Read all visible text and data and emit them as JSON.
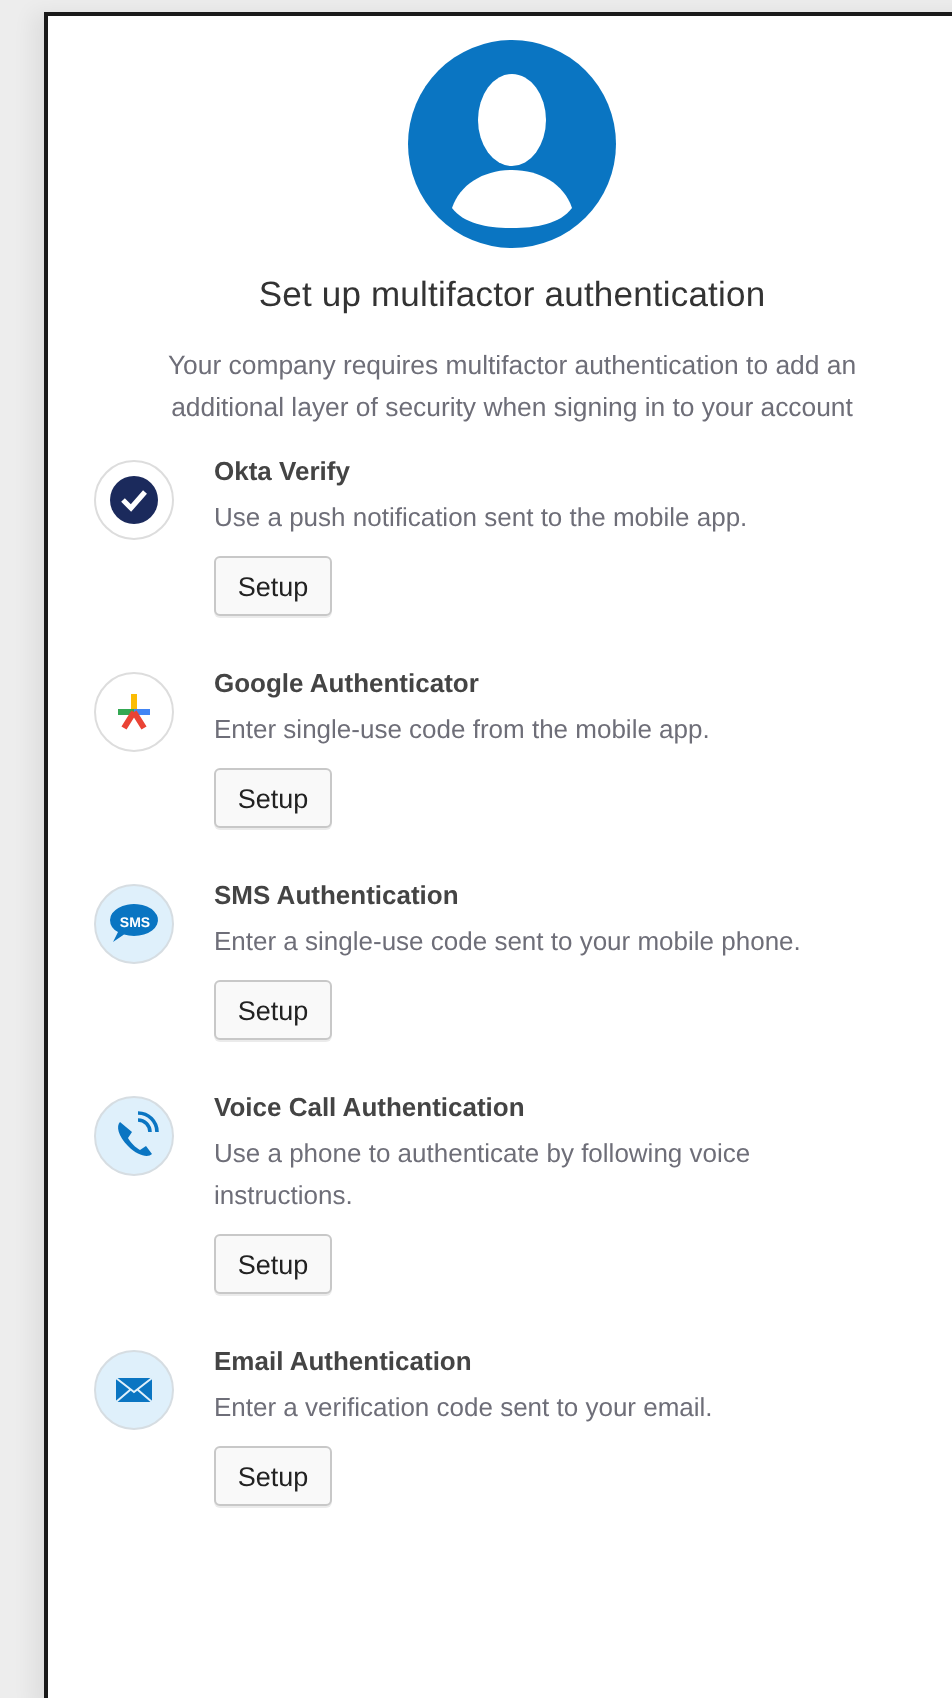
{
  "title": "Set up multifactor authentication",
  "subtitle": "Your company requires multifactor authentication to add an additional layer of security when signing in to your account",
  "factors": [
    {
      "kind": "okta",
      "name": "Okta Verify",
      "description": "Use a push notification sent to the mobile app.",
      "button": "Setup"
    },
    {
      "kind": "google",
      "name": "Google Authenticator",
      "description": "Enter single-use code from the mobile app.",
      "button": "Setup"
    },
    {
      "kind": "sms",
      "icon_text": "SMS",
      "name": "SMS Authentication",
      "description": "Enter a single-use code sent to your mobile phone.",
      "button": "Setup"
    },
    {
      "kind": "voice",
      "name": "Voice Call Authentication",
      "description": "Use a phone to authenticate by following voice instructions.",
      "button": "Setup"
    },
    {
      "kind": "email",
      "name": "Email Authentication",
      "description": "Enter a verification code sent to your email.",
      "button": "Setup"
    }
  ]
}
